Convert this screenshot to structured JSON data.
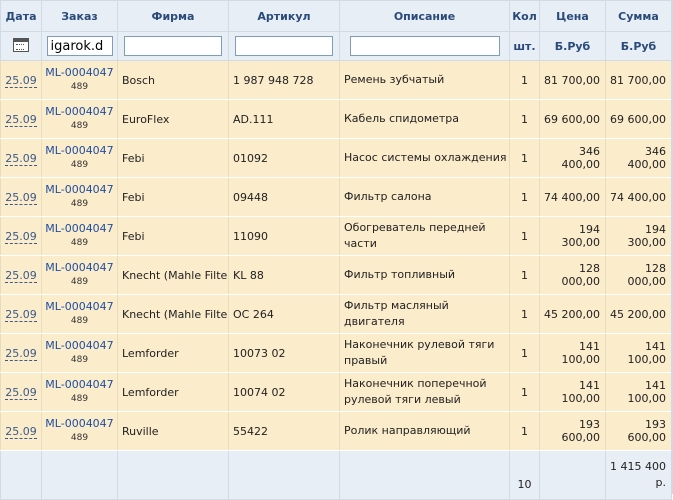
{
  "headers": {
    "date": "Дата",
    "order": "Заказ",
    "firm": "Фирма",
    "article": "Артикул",
    "description": "Описание",
    "qty": "Кол",
    "price": "Цена",
    "sum": "Сумма"
  },
  "units": {
    "qty": "шт.",
    "price": "Б.Руб",
    "sum": "Б.Руб"
  },
  "filters": {
    "order_value": "igarok.d",
    "firm_value": "",
    "article_value": "",
    "description_value": ""
  },
  "rows": [
    {
      "date": "25.09",
      "order": "ML-0004047",
      "sub": "489",
      "firm": "Bosch",
      "article": "1 987 948 728",
      "description": "Ремень зубчатый",
      "qty": "1",
      "price": "81 700,00",
      "sum": "81 700,00"
    },
    {
      "date": "25.09",
      "order": "ML-0004047",
      "sub": "489",
      "firm": "EuroFlex",
      "article": "AD.111",
      "description": "Кабель спидометра",
      "qty": "1",
      "price": "69 600,00",
      "sum": "69 600,00"
    },
    {
      "date": "25.09",
      "order": "ML-0004047",
      "sub": "489",
      "firm": "Febi",
      "article": "01092",
      "description": "Насос системы охлаждения",
      "qty": "1",
      "price": "346 400,00",
      "sum": "346 400,00"
    },
    {
      "date": "25.09",
      "order": "ML-0004047",
      "sub": "489",
      "firm": "Febi",
      "article": "09448",
      "description": "Фильтр салона",
      "qty": "1",
      "price": "74 400,00",
      "sum": "74 400,00"
    },
    {
      "date": "25.09",
      "order": "ML-0004047",
      "sub": "489",
      "firm": "Febi",
      "article": "11090",
      "description": "Обогреватель передней части",
      "qty": "1",
      "price": "194 300,00",
      "sum": "194 300,00"
    },
    {
      "date": "25.09",
      "order": "ML-0004047",
      "sub": "489",
      "firm": "Knecht (Mahle Filter)",
      "article": "KL 88",
      "description": "Фильтр топливный",
      "qty": "1",
      "price": "128 000,00",
      "sum": "128 000,00"
    },
    {
      "date": "25.09",
      "order": "ML-0004047",
      "sub": "489",
      "firm": "Knecht (Mahle Filter)",
      "article": "OC 264",
      "description": "Фильтр масляный двигателя",
      "qty": "1",
      "price": "45 200,00",
      "sum": "45 200,00"
    },
    {
      "date": "25.09",
      "order": "ML-0004047",
      "sub": "489",
      "firm": "Lemforder",
      "article": "10073 02",
      "description": "Наконечник рулевой тяги правый",
      "qty": "1",
      "price": "141 100,00",
      "sum": "141 100,00"
    },
    {
      "date": "25.09",
      "order": "ML-0004047",
      "sub": "489",
      "firm": "Lemforder",
      "article": "10074 02",
      "description": "Наконечник поперечной рулевой тяги левый",
      "qty": "1",
      "price": "141 100,00",
      "sum": "141 100,00"
    },
    {
      "date": "25.09",
      "order": "ML-0004047",
      "sub": "489",
      "firm": "Ruville",
      "article": "55422",
      "description": "Ролик направляющий",
      "qty": "1",
      "price": "193 600,00",
      "sum": "193 600,00"
    }
  ],
  "totals": {
    "qty": "10",
    "sum": "1 415 400 р."
  },
  "icons": {
    "date_filter": "calendar-icon"
  }
}
